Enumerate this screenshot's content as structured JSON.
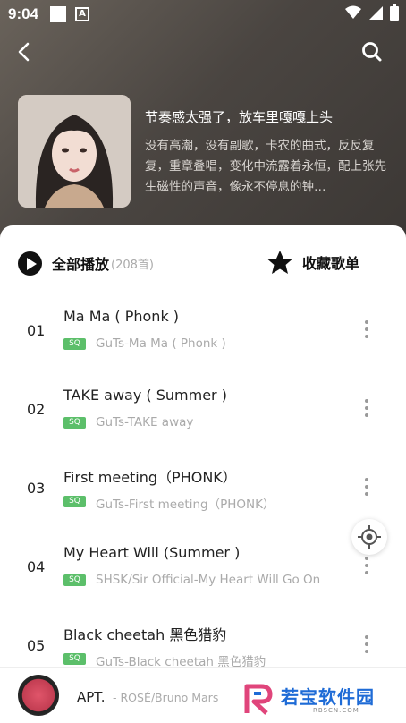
{
  "status": {
    "time": "9:04"
  },
  "header": {
    "back_icon": "back-arrow-icon",
    "search_icon": "search-icon"
  },
  "playlist": {
    "title": "节奏感太强了，放车里嘎嘎上头",
    "description": "没有高潮，没有副歌，卡农的曲式，反反复复，重章叠唱，变化中流露着永恒，配上张先生磁性的声音，像永不停息的钟…"
  },
  "actions": {
    "play_all": "全部播放",
    "count": "(208首)",
    "collect": "收藏歌单"
  },
  "songs": [
    {
      "num": "01",
      "title": "Ma Ma ( Phonk )",
      "badge": "SQ",
      "sub": "GuTs-Ma Ma ( Phonk )"
    },
    {
      "num": "02",
      "title": "TAKE away ( Summer )",
      "badge": "SQ",
      "sub": "GuTs-TAKE away"
    },
    {
      "num": "03",
      "title": "First meeting（PHONK）",
      "badge": "SQ",
      "sub": "GuTs-First meeting（PHONK）"
    },
    {
      "num": "04",
      "title": "My Heart Will (Summer )",
      "badge": "SQ",
      "sub": "SHSK/Sir Official-My Heart Will Go On"
    },
    {
      "num": "05",
      "title": "Black cheetah 黑色猎豹",
      "badge": "SQ",
      "sub": "GuTs-Black cheetah 黑色猎豹"
    }
  ],
  "now_playing": {
    "title": "APT.",
    "artist": "- ROSÉ/Bruno Mars"
  },
  "watermark": {
    "name": "若宝软件园",
    "url": "RBSCN.COM"
  },
  "colors": {
    "accent_green": "#5cbf6a",
    "logo_blue": "#1e6bd6"
  }
}
